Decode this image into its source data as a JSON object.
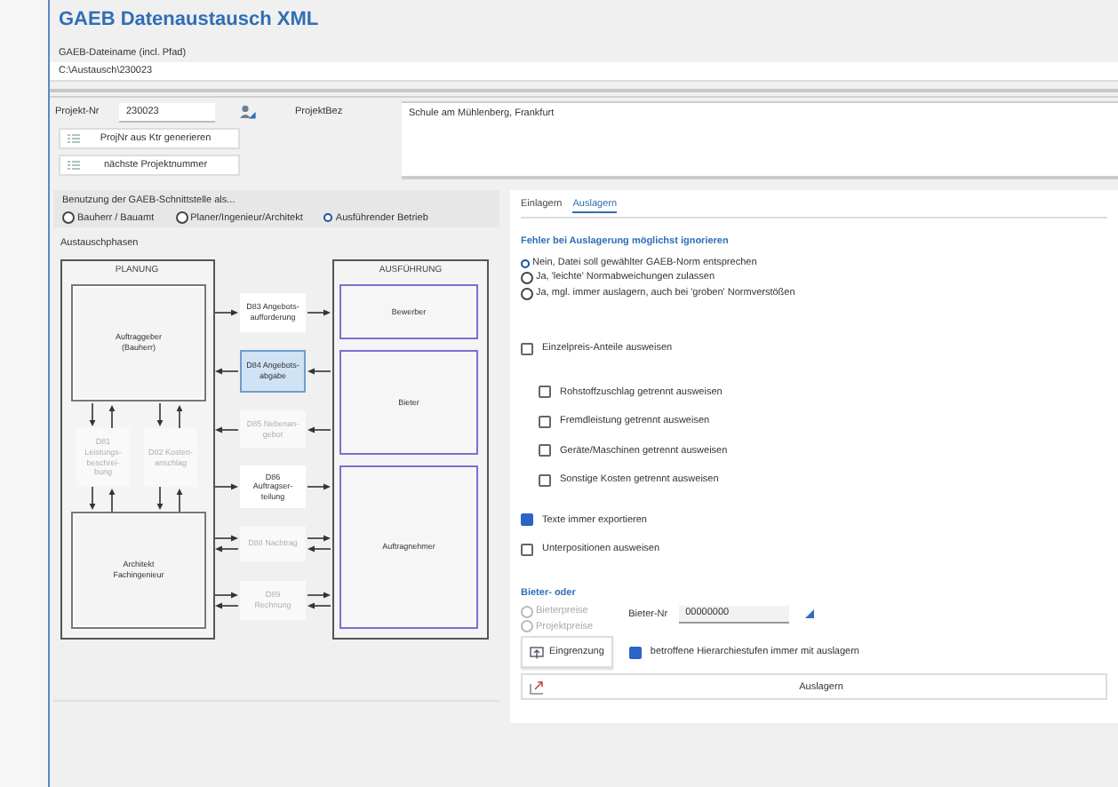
{
  "window": {
    "title": "GAEB Datenaustausch XML"
  },
  "file": {
    "label": "GAEB-Dateiname (incl. Pfad)",
    "value": "C:\\Austausch\\230023"
  },
  "project": {
    "number_label": "Projekt-Nr",
    "number": "230023",
    "description_label": "ProjektBez",
    "description": "Schule am Mühlenberg, Frankfurt",
    "buttons": [
      "ProjNr aus Ktr generieren",
      "nächste Projektnummer"
    ]
  },
  "usage": {
    "label": "Benutzung der GAEB-Schnittstelle als...",
    "options": [
      {
        "label": "Bauherr / Bauamt",
        "selected": false
      },
      {
        "label": "Planer/Ingenieur/Architekt",
        "selected": false
      },
      {
        "label": "Ausführender Betrieb",
        "selected": true
      }
    ]
  },
  "diagram": {
    "label": "Austauschphasen",
    "planning": {
      "title": "PLANUNG",
      "actors": [
        "Auftraggeber\n(Bauherr)",
        "Architekt\nFachingenieur"
      ],
      "documents": [
        {
          "label": "D81\nLeistungs-\nbeschrei-\nbung",
          "enabled": false
        },
        {
          "label": "D82 Kosten-\nanschlag",
          "enabled": false
        }
      ]
    },
    "exchanges": [
      {
        "label": "D83 Angebots-\naufforderung",
        "enabled": true,
        "selected": false,
        "kind": "outgoing"
      },
      {
        "label": "D84 Angebots-\nabgabe",
        "enabled": true,
        "selected": true,
        "kind": "incoming"
      },
      {
        "label": "D85 Nebenan-\ngebot",
        "enabled": false,
        "selected": false,
        "kind": "incoming"
      },
      {
        "label": "D86\nAuftragser-\nteilung",
        "enabled": true,
        "selected": false,
        "kind": "outgoing"
      },
      {
        "label": "D88 Nachtrag",
        "enabled": false,
        "selected": false,
        "kind": "mutual"
      },
      {
        "label": "D89\nRechnung",
        "enabled": false,
        "selected": false,
        "kind": "mutual"
      }
    ],
    "execution": {
      "title": "AUSFÜHRUNG",
      "actors": [
        "Bewerber",
        "Bieter",
        "Auftragnehmer"
      ]
    }
  },
  "tabs": [
    {
      "label": "Einlagern",
      "selected": false
    },
    {
      "label": "Auslagern",
      "selected": true
    }
  ],
  "errors": {
    "heading": "Fehler bei Auslagerung möglichst ignorieren",
    "options": [
      {
        "label": "Nein, Datei soll gewählter GAEB-Norm entsprechen",
        "selected": true
      },
      {
        "label": "Ja, 'leichte' Normabweichungen zulassen",
        "selected": false
      },
      {
        "label": "Ja, mgl. immer auslagern, auch bei 'groben' Normverstößen",
        "selected": false
      }
    ]
  },
  "checks": [
    {
      "label": "Einzelpreis-Anteile ausweisen",
      "checked": false,
      "children": [
        {
          "label": "Rohstoffzuschlag getrennt ausweisen",
          "checked": false
        },
        {
          "label": "Fremdleistung getrennt ausweisen",
          "checked": false
        },
        {
          "label": "Geräte/Maschinen getrennt ausweisen",
          "checked": false
        },
        {
          "label": "Sonstige Kosten getrennt ausweisen",
          "checked": false
        }
      ]
    },
    {
      "label": "Texte immer exportieren",
      "checked": true
    },
    {
      "label": "Unterpositionen ausweisen",
      "checked": false
    }
  ],
  "bidder": {
    "heading": "Bieter- oder",
    "options": [
      {
        "label": "Bieterpreise",
        "selected": false,
        "disabled": true
      },
      {
        "label": "Projektpreise",
        "selected": false,
        "disabled": true
      }
    ],
    "number_label": "Bieter-Nr",
    "number": "00000000",
    "filter_button": "Eingrenzung",
    "hierarchy": {
      "label": "betroffene Hierarchiestufen immer mit auslagern",
      "checked": true
    }
  },
  "export_button": "Auslagern"
}
